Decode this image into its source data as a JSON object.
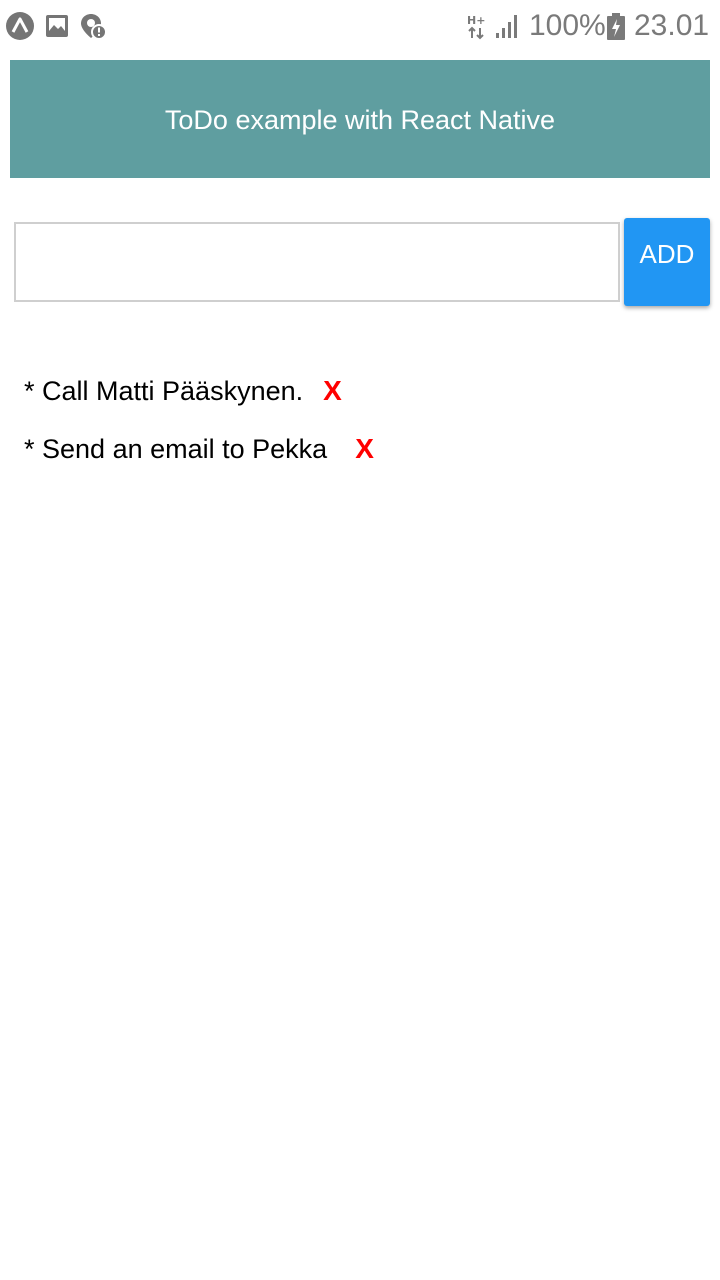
{
  "status_bar": {
    "icons": [
      "expo-icon",
      "gallery-icon",
      "location-alert-icon"
    ],
    "network_label": "H+",
    "battery_percent": "100%",
    "time": "23.01"
  },
  "header": {
    "title": "ToDo example with React Native",
    "background": "#5f9ea0"
  },
  "form": {
    "input_value": "",
    "input_placeholder": "",
    "add_label": "ADD",
    "add_color": "#2196f3"
  },
  "todos": [
    {
      "text": "* Call Matti Pääskynen.",
      "delete_label": "X"
    },
    {
      "text": "* Send an email to Pekka",
      "delete_label": "X"
    }
  ],
  "colors": {
    "delete": "#ff0000"
  }
}
